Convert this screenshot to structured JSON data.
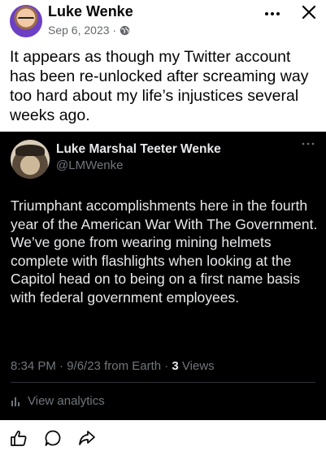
{
  "post": {
    "author": "Luke Wenke",
    "date": "Sep 6, 2023 ·",
    "privacy_icon": "globe-icon",
    "text": "It appears as though my Twitter account has been re-unlocked after screaming way too hard about my life’s injustices several weeks ago."
  },
  "tweet": {
    "name": "Luke Marshal Teeter Wenke",
    "handle": "@LMWenke",
    "text": "Triumphant accomplishments here in the fourth year of the American War With The Government.  We’ve gone from wearing mining helmets complete with flashlights when looking at the Capitol head on to being on a first name basis with federal government employees.",
    "meta_prefix": "8:34 PM · 9/6/23 from Earth · ",
    "views_count": "3",
    "views_label": " Views",
    "analytics_label": "View analytics"
  },
  "actions": {
    "like_icon": "thumbs-up-icon",
    "comment_icon": "comment-icon",
    "share_icon": "share-icon"
  },
  "colors": {
    "fb_text": "#050505",
    "fb_meta": "#65676b",
    "tweet_bg": "#000000",
    "tweet_text": "#e7e9ea",
    "tweet_muted": "#71767b"
  }
}
